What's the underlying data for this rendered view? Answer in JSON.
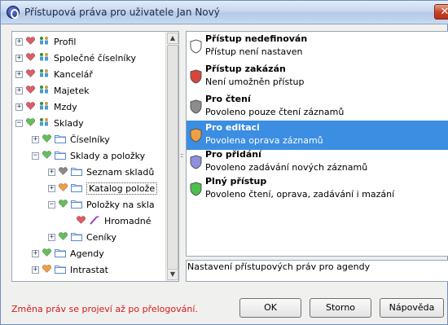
{
  "window": {
    "title": "Přístupová práva pro uživatele Jan Nový",
    "close_label": "✕"
  },
  "tree": {
    "items": [
      {
        "label": "Profil",
        "expander": "+",
        "heart": "#e05a6a",
        "icon": "people-icon"
      },
      {
        "label": "Společné číselníky",
        "expander": "+",
        "heart": "#e05a6a",
        "icon": "people-icon"
      },
      {
        "label": "Kancelář",
        "expander": "+",
        "heart": "#e05a6a",
        "icon": "people-icon"
      },
      {
        "label": "Majetek",
        "expander": "+",
        "heart": "#e05a6a",
        "icon": "people-icon"
      },
      {
        "label": "Mzdy",
        "expander": "+",
        "heart": "#e05a6a",
        "icon": "people-icon"
      },
      {
        "label": "Sklady",
        "expander": "−",
        "heart": "#5ac45a",
        "icon": "people-icon"
      },
      {
        "label": "Číselníky",
        "expander": "+",
        "heart": "#5ac45a",
        "icon": "folder-icon"
      },
      {
        "label": "Sklady a položky",
        "expander": "−",
        "heart": "#5ac45a",
        "icon": "folder-icon"
      },
      {
        "label": "Seznam skladů",
        "expander": "+",
        "heart": "#8a8a8a",
        "icon": "folder-icon"
      },
      {
        "label": "Katalog polože",
        "expander": "+",
        "heart": "#f0a040",
        "icon": "folder-icon"
      },
      {
        "label": "Položky na skla",
        "expander": "−",
        "heart": "#5ac45a",
        "icon": "folder-icon"
      },
      {
        "label": "Hromadné",
        "expander": "",
        "heart": "#e05a6a",
        "icon": "wand-icon"
      },
      {
        "label": "Ceníky",
        "expander": "+",
        "heart": "#5ac45a",
        "icon": "folder-icon"
      },
      {
        "label": "Agendy",
        "expander": "+",
        "heart": "#5ac45a",
        "icon": "folder-icon"
      },
      {
        "label": "Intrastat",
        "expander": "+",
        "heart": "#f0a040",
        "icon": "folder-icon"
      }
    ],
    "scroll_up": "▲",
    "scroll_down": "▼",
    "splitter_grip": "::"
  },
  "permissions": [
    {
      "title": "Přístup nedefinován",
      "desc": "Přístup není nastaven",
      "color": "#ffffff"
    },
    {
      "title": "Přístup zakázán",
      "desc": "Není umožněn přístup",
      "color": "#d8453a"
    },
    {
      "title": "Pro čtení",
      "desc": "Povoleno pouze čtení záznamů",
      "color": "#8c8c8c"
    },
    {
      "title": "Pro editaci",
      "desc": "Povolena oprava záznamů",
      "color": "#f0a040"
    },
    {
      "title": "Pro přidání",
      "desc": "Povoleno zadávání nových záznamů",
      "color": "#8f8fe0"
    },
    {
      "title": "Plný přístup",
      "desc": "Povoleno čtení, oprava, zadávání i mazání",
      "color": "#4cbf4c"
    }
  ],
  "selected_permission": "Pro editaci",
  "description": "Nastavení přístupových práv pro agendy",
  "footer": {
    "note": "Změna práv se projeví až po přelogování.",
    "ok": "OK",
    "cancel": "Storno",
    "help": "Nápověda"
  }
}
